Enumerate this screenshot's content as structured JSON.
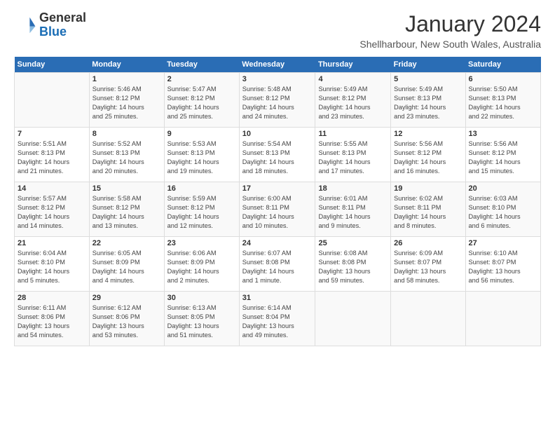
{
  "header": {
    "logo_line1": "General",
    "logo_line2": "Blue",
    "month_title": "January 2024",
    "subtitle": "Shellharbour, New South Wales, Australia"
  },
  "days_of_week": [
    "Sunday",
    "Monday",
    "Tuesday",
    "Wednesday",
    "Thursday",
    "Friday",
    "Saturday"
  ],
  "weeks": [
    [
      {
        "day": "",
        "info": ""
      },
      {
        "day": "1",
        "info": "Sunrise: 5:46 AM\nSunset: 8:12 PM\nDaylight: 14 hours\nand 25 minutes."
      },
      {
        "day": "2",
        "info": "Sunrise: 5:47 AM\nSunset: 8:12 PM\nDaylight: 14 hours\nand 25 minutes."
      },
      {
        "day": "3",
        "info": "Sunrise: 5:48 AM\nSunset: 8:12 PM\nDaylight: 14 hours\nand 24 minutes."
      },
      {
        "day": "4",
        "info": "Sunrise: 5:49 AM\nSunset: 8:12 PM\nDaylight: 14 hours\nand 23 minutes."
      },
      {
        "day": "5",
        "info": "Sunrise: 5:49 AM\nSunset: 8:13 PM\nDaylight: 14 hours\nand 23 minutes."
      },
      {
        "day": "6",
        "info": "Sunrise: 5:50 AM\nSunset: 8:13 PM\nDaylight: 14 hours\nand 22 minutes."
      }
    ],
    [
      {
        "day": "7",
        "info": "Sunrise: 5:51 AM\nSunset: 8:13 PM\nDaylight: 14 hours\nand 21 minutes."
      },
      {
        "day": "8",
        "info": "Sunrise: 5:52 AM\nSunset: 8:13 PM\nDaylight: 14 hours\nand 20 minutes."
      },
      {
        "day": "9",
        "info": "Sunrise: 5:53 AM\nSunset: 8:13 PM\nDaylight: 14 hours\nand 19 minutes."
      },
      {
        "day": "10",
        "info": "Sunrise: 5:54 AM\nSunset: 8:13 PM\nDaylight: 14 hours\nand 18 minutes."
      },
      {
        "day": "11",
        "info": "Sunrise: 5:55 AM\nSunset: 8:13 PM\nDaylight: 14 hours\nand 17 minutes."
      },
      {
        "day": "12",
        "info": "Sunrise: 5:56 AM\nSunset: 8:12 PM\nDaylight: 14 hours\nand 16 minutes."
      },
      {
        "day": "13",
        "info": "Sunrise: 5:56 AM\nSunset: 8:12 PM\nDaylight: 14 hours\nand 15 minutes."
      }
    ],
    [
      {
        "day": "14",
        "info": "Sunrise: 5:57 AM\nSunset: 8:12 PM\nDaylight: 14 hours\nand 14 minutes."
      },
      {
        "day": "15",
        "info": "Sunrise: 5:58 AM\nSunset: 8:12 PM\nDaylight: 14 hours\nand 13 minutes."
      },
      {
        "day": "16",
        "info": "Sunrise: 5:59 AM\nSunset: 8:12 PM\nDaylight: 14 hours\nand 12 minutes."
      },
      {
        "day": "17",
        "info": "Sunrise: 6:00 AM\nSunset: 8:11 PM\nDaylight: 14 hours\nand 10 minutes."
      },
      {
        "day": "18",
        "info": "Sunrise: 6:01 AM\nSunset: 8:11 PM\nDaylight: 14 hours\nand 9 minutes."
      },
      {
        "day": "19",
        "info": "Sunrise: 6:02 AM\nSunset: 8:11 PM\nDaylight: 14 hours\nand 8 minutes."
      },
      {
        "day": "20",
        "info": "Sunrise: 6:03 AM\nSunset: 8:10 PM\nDaylight: 14 hours\nand 6 minutes."
      }
    ],
    [
      {
        "day": "21",
        "info": "Sunrise: 6:04 AM\nSunset: 8:10 PM\nDaylight: 14 hours\nand 5 minutes."
      },
      {
        "day": "22",
        "info": "Sunrise: 6:05 AM\nSunset: 8:09 PM\nDaylight: 14 hours\nand 4 minutes."
      },
      {
        "day": "23",
        "info": "Sunrise: 6:06 AM\nSunset: 8:09 PM\nDaylight: 14 hours\nand 2 minutes."
      },
      {
        "day": "24",
        "info": "Sunrise: 6:07 AM\nSunset: 8:08 PM\nDaylight: 14 hours\nand 1 minute."
      },
      {
        "day": "25",
        "info": "Sunrise: 6:08 AM\nSunset: 8:08 PM\nDaylight: 13 hours\nand 59 minutes."
      },
      {
        "day": "26",
        "info": "Sunrise: 6:09 AM\nSunset: 8:07 PM\nDaylight: 13 hours\nand 58 minutes."
      },
      {
        "day": "27",
        "info": "Sunrise: 6:10 AM\nSunset: 8:07 PM\nDaylight: 13 hours\nand 56 minutes."
      }
    ],
    [
      {
        "day": "28",
        "info": "Sunrise: 6:11 AM\nSunset: 8:06 PM\nDaylight: 13 hours\nand 54 minutes."
      },
      {
        "day": "29",
        "info": "Sunrise: 6:12 AM\nSunset: 8:06 PM\nDaylight: 13 hours\nand 53 minutes."
      },
      {
        "day": "30",
        "info": "Sunrise: 6:13 AM\nSunset: 8:05 PM\nDaylight: 13 hours\nand 51 minutes."
      },
      {
        "day": "31",
        "info": "Sunrise: 6:14 AM\nSunset: 8:04 PM\nDaylight: 13 hours\nand 49 minutes."
      },
      {
        "day": "",
        "info": ""
      },
      {
        "day": "",
        "info": ""
      },
      {
        "day": "",
        "info": ""
      }
    ]
  ]
}
